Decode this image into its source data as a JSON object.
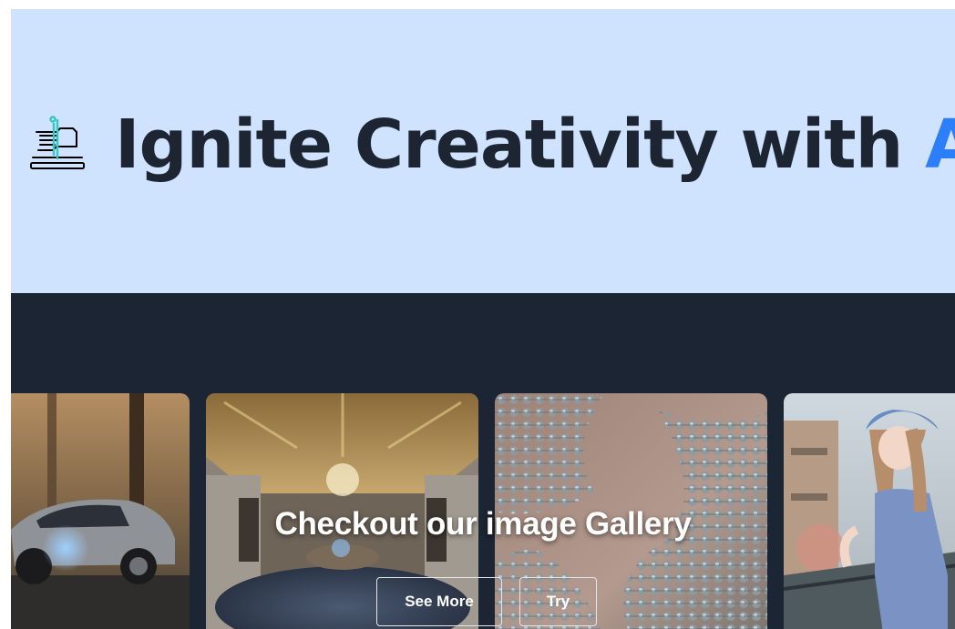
{
  "hero": {
    "icon": "hand-hologram-icon",
    "title_main": "Ignite Creativity with ",
    "title_accent": "AI",
    "background": "#cfe2fe",
    "accent_color": "#2d7ff9",
    "text_color": "#1d2532"
  },
  "gallery": {
    "background": "#1c2533",
    "heading": "Checkout our image Gallery",
    "buttons": {
      "see_more": "See More",
      "try": "Try"
    },
    "images": [
      {
        "icon": "car-in-forest-image"
      },
      {
        "icon": "ornate-hall-image"
      },
      {
        "icon": "molecular-structure-image"
      },
      {
        "icon": "anime-girl-image"
      }
    ]
  }
}
